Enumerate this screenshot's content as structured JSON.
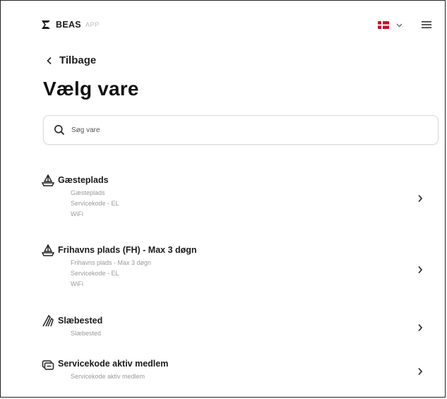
{
  "header": {
    "logo_text": "BEAS",
    "logo_sub": "APP",
    "language_flag": "danish-flag",
    "colors": {
      "flag_red": "#c8102e",
      "text": "#111111",
      "muted": "#9a9a9a"
    }
  },
  "nav": {
    "back_label": "Tilbage"
  },
  "page": {
    "title": "Vælg vare"
  },
  "search": {
    "placeholder": "Søg vare",
    "value": ""
  },
  "items": [
    {
      "icon": "boat-icon",
      "title": "Gæsteplads",
      "lines": [
        "Gæsteplads",
        "Servicekode - EL",
        "WiFi"
      ]
    },
    {
      "icon": "boat-icon",
      "title": "Frihavns plads (FH) - Max 3 døgn",
      "lines": [
        "Frihavns plads - Max 3 døgn",
        "Servicekode - EL",
        "WiFi"
      ]
    },
    {
      "icon": "slipway-icon",
      "title": "Slæbested",
      "lines": [
        "Slæbested"
      ]
    },
    {
      "icon": "membership-card-icon",
      "title": "Servicekode aktiv medlem",
      "lines": [
        "Servicekode aktiv medlem"
      ]
    }
  ]
}
